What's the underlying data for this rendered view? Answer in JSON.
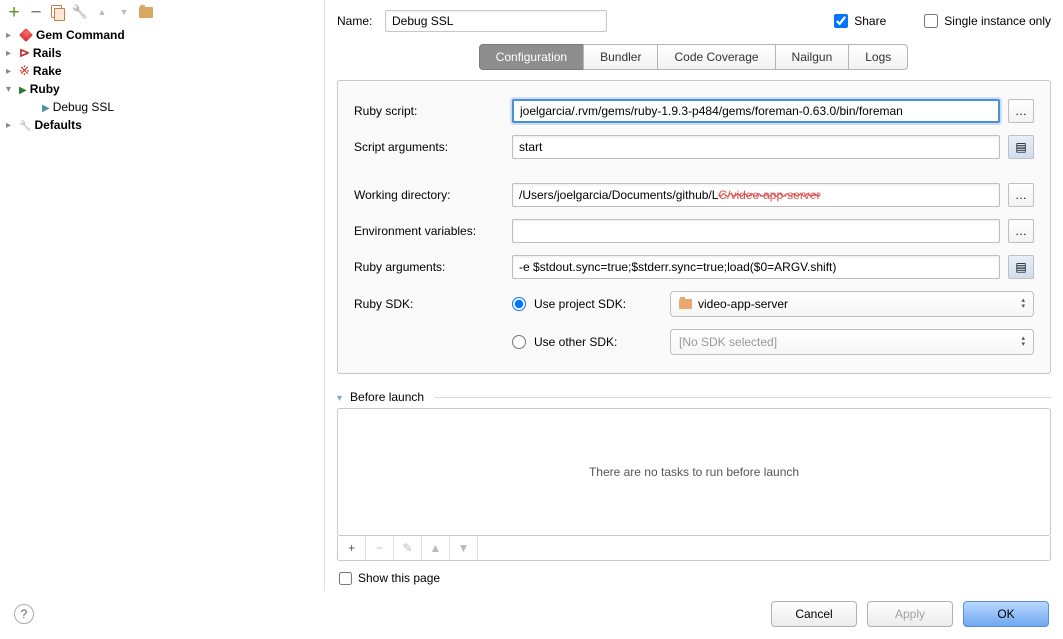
{
  "toolbar": {
    "add": "+",
    "remove": "−"
  },
  "tree": {
    "items": [
      {
        "label": "Gem Command"
      },
      {
        "label": "Rails"
      },
      {
        "label": "Rake"
      },
      {
        "label": "Ruby"
      },
      {
        "label": "Debug SSL"
      },
      {
        "label": "Defaults"
      }
    ]
  },
  "name": {
    "label": "Name:",
    "value": "Debug SSL"
  },
  "share": {
    "label": "Share",
    "checked": true
  },
  "singleInstance": {
    "label": "Single instance only",
    "checked": false
  },
  "tabs": [
    "Configuration",
    "Bundler",
    "Code Coverage",
    "Nailgun",
    "Logs"
  ],
  "form": {
    "rubyScriptLabel": "Ruby script:",
    "rubyScriptValue": "joelgarcia/.rvm/gems/ruby-1.9.3-p484/gems/foreman-0.63.0/bin/foreman",
    "scriptArgsLabel": "Script arguments:",
    "scriptArgsValue": "start",
    "workingDirLabel": "Working directory:",
    "workingDirValue": "/Users/joelgarcia/Documents/github/L",
    "workingDirStrike": "C/video-app-server",
    "envVarsLabel": "Environment variables:",
    "envVarsValue": "",
    "rubyArgsLabel": "Ruby arguments:",
    "rubyArgsValue": "-e $stdout.sync=true;$stderr.sync=true;load($0=ARGV.shift)",
    "rubySdkLabel": "Ruby SDK:",
    "useProjectSdk": "Use project SDK:",
    "projectSdkValue": "video-app-server",
    "useOtherSdk": "Use other SDK:",
    "otherSdkValue": "[No SDK selected]"
  },
  "beforeLaunch": {
    "title": "Before launch",
    "empty": "There are no tasks to run before launch",
    "showPage": "Show this page"
  },
  "buttons": {
    "cancel": "Cancel",
    "apply": "Apply",
    "ok": "OK"
  },
  "help": "?"
}
